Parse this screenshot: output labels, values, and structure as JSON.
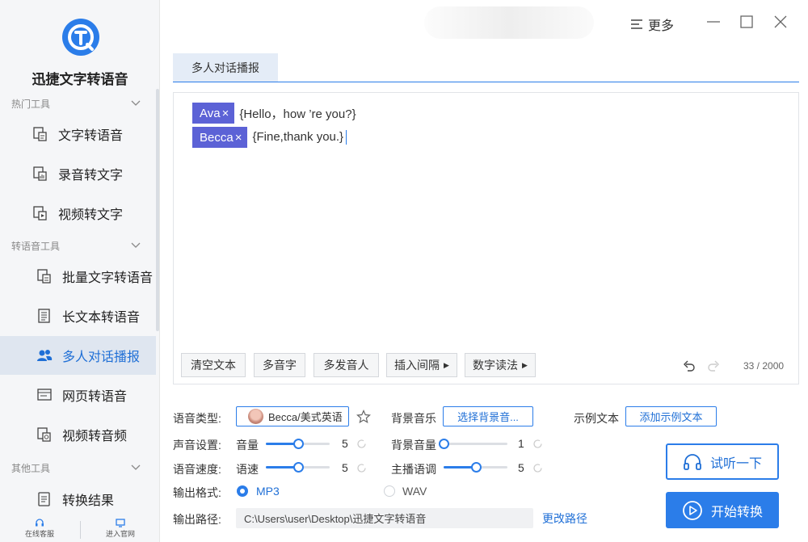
{
  "app": {
    "name": "迅捷文字转语音"
  },
  "titlebar": {
    "more_label": "更多"
  },
  "sidebar": {
    "groups": [
      {
        "title": "热门工具",
        "items": [
          "文字转语音",
          "录音转文字",
          "视频转文字"
        ]
      },
      {
        "title": "转语音工具",
        "items": [
          "批量文字转语音",
          "长文本转语音",
          "多人对话播报",
          "网页转语音",
          "视频转音频"
        ]
      },
      {
        "title": "其他工具",
        "items": [
          "转换结果"
        ]
      }
    ],
    "active_item": "多人对话播报",
    "bottom": {
      "service": "在线客服",
      "website": "进入官网"
    }
  },
  "tab": {
    "label": "多人对话播报"
  },
  "editor": {
    "lines": [
      {
        "speaker": "Ava",
        "remove": "×",
        "text": "{Hello，how ’re you?}"
      },
      {
        "speaker": "Becca",
        "remove": "×",
        "text": "{Fine,thank you.}"
      }
    ],
    "buttons": [
      "清空文本",
      "多音字",
      "多发音人",
      "插入间隔",
      "数字读法"
    ],
    "counter": "33 / 2000"
  },
  "settings": {
    "voice_type_label": "语音类型:",
    "voice_value": "Becca/美式英语",
    "bg_music_label": "背景音乐",
    "bg_music_button": "选择背景音...",
    "sample_text_label": "示例文本",
    "sample_text_button": "添加示例文本",
    "sound_label": "声音设置:",
    "volume_label": "音量",
    "volume_value": "5",
    "volume_level": 0.5,
    "bg_volume_label": "背景音量",
    "bg_volume_value": "1",
    "bg_volume_level": 0.0,
    "speed_label": "语音速度:",
    "rate_label": "语速",
    "rate_value": "5",
    "rate_level": 0.5,
    "pitch_label": "主播语调",
    "pitch_value": "5",
    "pitch_level": 0.5,
    "format_label": "输出格式:",
    "format_mp3": "MP3",
    "format_wav": "WAV",
    "format_selected": "MP3",
    "path_label": "输出路径:",
    "path_value": "C:\\Users\\user\\Desktop\\迅捷文字转语音",
    "change_path": "更改路径"
  },
  "actions": {
    "try_label": "试听一下",
    "start_label": "开始转换"
  },
  "colors": {
    "accent": "#2b7de9",
    "speaker_tag": "#5c62d6",
    "sidebar_bg": "#f5f6f8",
    "active_item_bg": "#dfe6f0"
  },
  "icons": {
    "logo": "logo-icon",
    "more": "menu-lines-icon",
    "minimize": "minimize-icon",
    "maximize": "maximize-icon",
    "close": "close-icon",
    "headphones": "headphones-icon",
    "convert": "play-circle-icon"
  }
}
